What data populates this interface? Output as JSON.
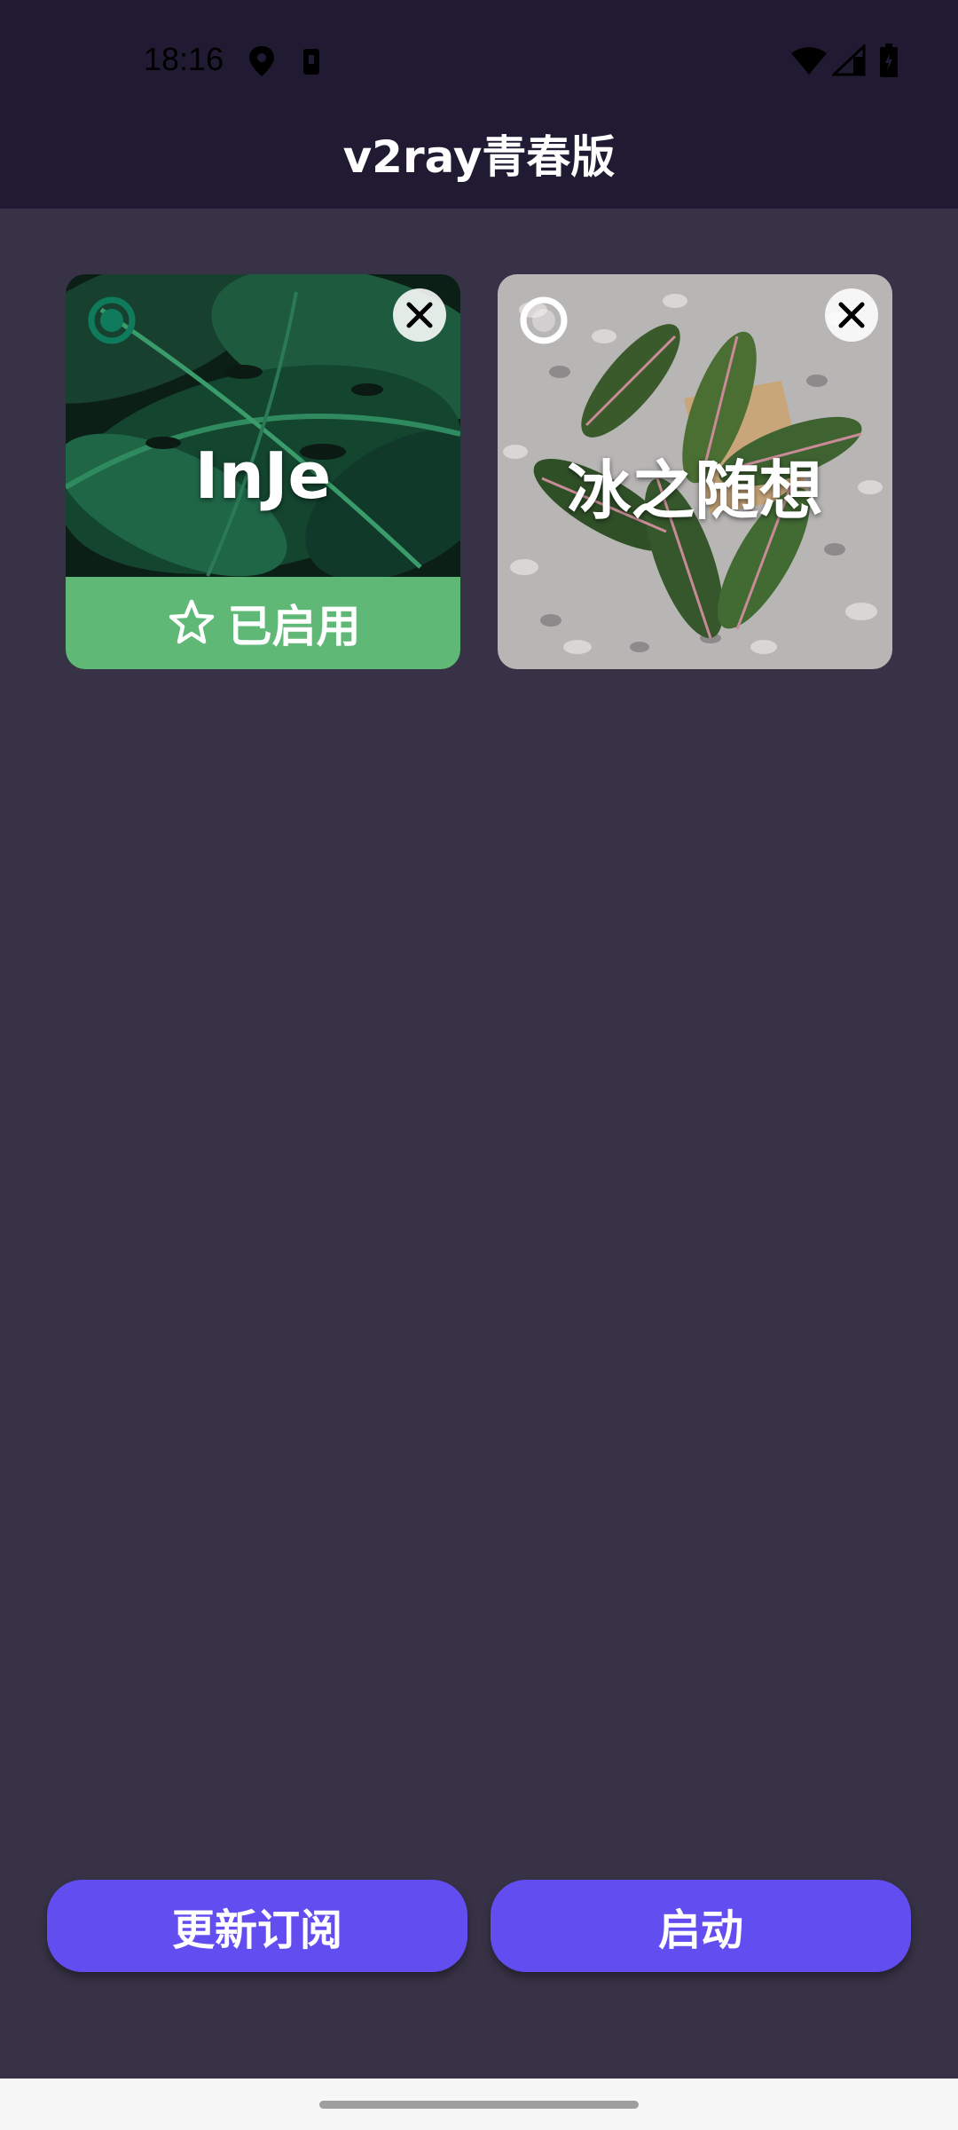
{
  "status_bar": {
    "time": "18:16",
    "icons": [
      "location-icon",
      "battery-saver-icon",
      "wifi-icon",
      "signal-icon",
      "battery-icon"
    ]
  },
  "app_bar": {
    "title": "v2ray青春版"
  },
  "subscriptions": [
    {
      "name": "InJe",
      "selected": true,
      "enabled_label": "已启用",
      "image": "monstera-leaves"
    },
    {
      "name": "冰之随想",
      "selected": false,
      "image": "potted-plant-on-gravel"
    }
  ],
  "actions": {
    "update_label": "更新订阅",
    "start_label": "启动"
  },
  "colors": {
    "app_bar": "#201b32",
    "background": "#383246",
    "enabled_badge": "#5fb876",
    "primary_button": "#624ef0",
    "selected_radio": "#0f7a5c"
  }
}
